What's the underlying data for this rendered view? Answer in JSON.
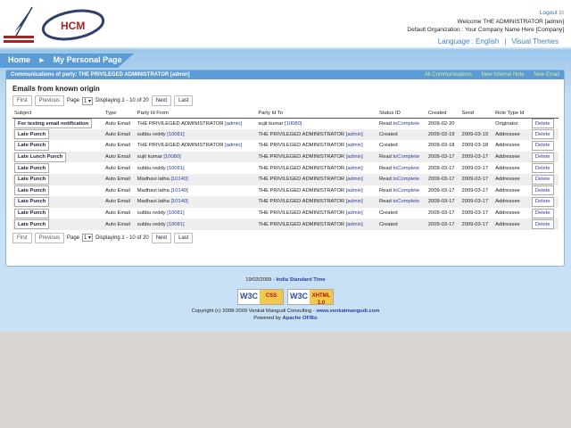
{
  "header": {
    "logo_text": "HCM",
    "logout": "Logout",
    "welcome": "Welcome THE ADMINISTRATOR [admin]",
    "organization": "Default Organization : Your Company Name Here [Company]",
    "language": "Language : English",
    "themes": "Visual Themes"
  },
  "nav": {
    "items": [
      "Home",
      "My Personal Page"
    ]
  },
  "panel": {
    "title": "Communications of party: THE PRIVILEGED ADMINISTRATOR [admin]",
    "links": [
      "All Communications",
      "New Internal Note",
      "New Email"
    ],
    "heading": "Emails from known origin"
  },
  "pager": {
    "first": "First",
    "previous": "Previous",
    "page_label": "Page",
    "page_value": "1",
    "display": "Displaying 1 - 10 of 20",
    "next": "Next",
    "last": "Last"
  },
  "columns": [
    "Subject",
    "Type",
    "Party Id From",
    "Party Id To",
    "Status ID",
    "Created",
    "Send",
    "Role Type Id",
    ""
  ],
  "rows": [
    {
      "subject": "For testing email notification",
      "type": "Auto Email",
      "from": "THE PRIVILEGED ADMINISTRATOR",
      "from_id": "[admin]",
      "to": "sujit kumar",
      "to_id": "[10080]",
      "status": "Read",
      "status_action": "toComplete",
      "created": "2009-02-20",
      "send": "",
      "role": "Originator",
      "del": "Delete"
    },
    {
      "subject": "Late Punch",
      "type": "Auto Email",
      "from": "subbu reddy",
      "from_id": "[10081]",
      "to": "THE PRIVILEGED ADMINISTRATOR",
      "to_id": "[admin]",
      "status": "Created",
      "status_action": "",
      "created": "2009-03-19",
      "send": "2009-03-19",
      "role": "Addressee",
      "del": "Delete"
    },
    {
      "subject": "Late Punch",
      "type": "Auto Email",
      "from": "THE PRIVILEGED ADMINISTRATOR",
      "from_id": "[admin]",
      "to": "THE PRIVILEGED ADMINISTRATOR",
      "to_id": "[admin]",
      "status": "Created",
      "status_action": "",
      "created": "2009-03-18",
      "send": "2009-03-18",
      "role": "Addressee",
      "del": "Delete"
    },
    {
      "subject": "Late Lunch Punch",
      "type": "Auto Email",
      "from": "sujit kumar",
      "from_id": "[10080]",
      "to": "THE PRIVILEGED ADMINISTRATOR",
      "to_id": "[admin]",
      "status": "Read",
      "status_action": "toComplete",
      "created": "2009-03-17",
      "send": "2009-03-17",
      "role": "Addressee",
      "del": "Delete"
    },
    {
      "subject": "Late Punch",
      "type": "Auto Email",
      "from": "subbu reddy",
      "from_id": "[10081]",
      "to": "THE PRIVILEGED ADMINISTRATOR",
      "to_id": "[admin]",
      "status": "Read",
      "status_action": "toComplete",
      "created": "2009-03-17",
      "send": "2009-03-17",
      "role": "Addressee",
      "del": "Delete"
    },
    {
      "subject": "Late Punch",
      "type": "Auto Email",
      "from": "Madhavi latha",
      "from_id": "[10140]",
      "to": "THE PRIVILEGED ADMINISTRATOR",
      "to_id": "[admin]",
      "status": "Read",
      "status_action": "toComplete",
      "created": "2009-03-17",
      "send": "2009-03-17",
      "role": "Addressee",
      "del": "Delete"
    },
    {
      "subject": "Late Punch",
      "type": "Auto Email",
      "from": "Madhavi latha",
      "from_id": "[10140]",
      "to": "THE PRIVILEGED ADMINISTRATOR",
      "to_id": "[admin]",
      "status": "Read",
      "status_action": "toComplete",
      "created": "2009-03-17",
      "send": "2009-03-17",
      "role": "Addressee",
      "del": "Delete"
    },
    {
      "subject": "Late Punch",
      "type": "Auto Email",
      "from": "Madhavi latha",
      "from_id": "[10140]",
      "to": "THE PRIVILEGED ADMINISTRATOR",
      "to_id": "[admin]",
      "status": "Read",
      "status_action": "toComplete",
      "created": "2009-03-17",
      "send": "2009-03-17",
      "role": "Addressee",
      "del": "Delete"
    },
    {
      "subject": "Late Punch",
      "type": "Auto Email",
      "from": "subbu reddy",
      "from_id": "[10081]",
      "to": "THE PRIVILEGED ADMINISTRATOR",
      "to_id": "[admin]",
      "status": "Created",
      "status_action": "",
      "created": "2009-03-17",
      "send": "2009-03-17",
      "role": "Addressee",
      "del": "Delete"
    },
    {
      "subject": "Late Punch",
      "type": "Auto Email",
      "from": "subbu reddy",
      "from_id": "[10081]",
      "to": "THE PRIVILEGED ADMINISTRATOR",
      "to_id": "[admin]",
      "status": "Created",
      "status_action": "",
      "created": "2009-03-17",
      "send": "2009-03-17",
      "role": "Addressee",
      "del": "Delete"
    }
  ],
  "footer": {
    "date": "19/03/2009",
    "tz": "India Standard Time",
    "w3c_css": [
      "W3C",
      "CSS"
    ],
    "w3c_xhtml": [
      "W3C",
      "XHTML 1.0"
    ],
    "copyright": "Copyright (c) 2008-2009 Venkat Mangudi Consulting -",
    "site": "www.venkatmangudi.com",
    "powered": "Powered by",
    "ofbiz": "Apache OFBiz"
  }
}
